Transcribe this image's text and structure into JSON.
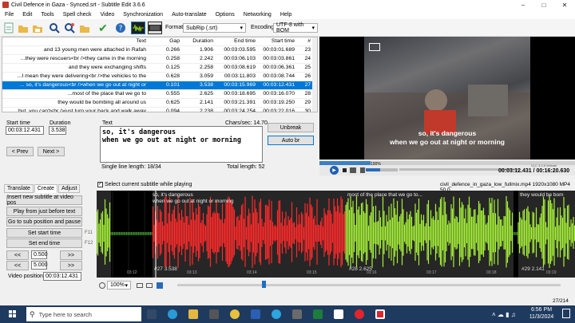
{
  "window": {
    "title": "Civil Defence in Gaza - Synced.srt - Subtitle Edit 3.6.6"
  },
  "menu": [
    "File",
    "Edit",
    "Tools",
    "Spell check",
    "Video",
    "Synchronization",
    "Auto-translate",
    "Options",
    "Networking",
    "Help"
  ],
  "toolbar": {
    "format_label": "Format",
    "format_value": "SubRip (.srt)",
    "encoding_label": "Encoding",
    "encoding_value": "UTF-8 with BOM",
    "icons": [
      "new-file-icon",
      "open-folder-icon",
      "save-icon",
      "save-as-icon",
      "find-icon",
      "replace-icon",
      "spell-check-icon",
      "help-icon",
      "waveform-toggle-icon",
      "video-toggle-icon"
    ]
  },
  "grid": {
    "headers": [
      "Text",
      "Gap",
      "Duration",
      "End time",
      "Start time",
      "#"
    ],
    "rows": [
      {
        "text": "and 13 young men were attached in Rafah",
        "gap": "0.266",
        "duration": "1.906",
        "end": "00:03:03.595",
        "start": "00:03:01.689",
        "num": "23"
      },
      {
        "text": "...they were rescuers<br />they came in the morning",
        "gap": "0.258",
        "duration": "2.242",
        "end": "00:03:06.103",
        "start": "00:03:03.861",
        "num": "24"
      },
      {
        "text": "and they were exchanging shifts",
        "gap": "0.125",
        "duration": "2.258",
        "end": "00:03:08.619",
        "start": "00:03:06.361",
        "num": "25"
      },
      {
        "text": "...I mean they were delivering<br />the vehicles to the",
        "gap": "0.628",
        "duration": "3.059",
        "end": "00:03:11.803",
        "start": "00:03:08.744",
        "num": "26"
      },
      {
        "text": "... so, it's dangerous<br />when we go out at night or",
        "gap": "0.101",
        "duration": "3.538",
        "end": "00:03:15.969",
        "start": "00:03:12.431",
        "num": "27",
        "selected": true
      },
      {
        "text": "...most of the place that we go to",
        "gap": "0.555",
        "duration": "2.625",
        "end": "00:03:18.695",
        "start": "00:03:16.070",
        "num": "28"
      },
      {
        "text": "they would be bombing all around us",
        "gap": "0.625",
        "duration": "2.141",
        "end": "00:03:21.391",
        "start": "00:03:19.250",
        "num": "29"
      },
      {
        "text": "but, you can't<br />just turn your back and walk away",
        "gap": "0.094",
        "duration": "2.238",
        "end": "00:03:24.254",
        "start": "00:03:22.016",
        "num": "30"
      }
    ]
  },
  "editor": {
    "start_time_label": "Start time",
    "start_time_value": "00:03:12.431",
    "duration_label": "Duration",
    "duration_value": "3.538",
    "prev_label": "< Prev",
    "next_label": "Next >",
    "text_label": "Text",
    "chars_sec": "Chars/sec: 14.70",
    "text_line1": "so, it's dangerous",
    "text_line2": "when we go out at night or morning",
    "single_line_length": "Single line length: 18/34",
    "total_length": "Total length: 52",
    "unbreak_label": "Unbreak",
    "autobr_label": "Auto br"
  },
  "video": {
    "subtitle_line1": "so, it's dangerous",
    "subtitle_line2": "when we go out at night or morning",
    "time_display": "00:03:12.431 / 00:16:20.630",
    "volume": "100%",
    "vlc_label": "VLC 3.0.8 Vetinari",
    "volume_fraction": 0.45,
    "progress_fraction": 0.2
  },
  "tabs": [
    "Translate",
    "Create",
    "Adjust"
  ],
  "active_tab": "Create",
  "create": {
    "insert_label": "Insert new subtitle at video pos",
    "play_label": "Play from just before text",
    "goto_label": "Go to sub position and pause",
    "set_start_label": "Set start time",
    "set_end_label": "Set end time",
    "f11": "F11",
    "f12": "F12",
    "step1_back": "<<",
    "step1_value": "0.500",
    "step1_fwd": ">>",
    "step2_back": "<<",
    "step2_value": "5.000",
    "step2_fwd": ">>",
    "video_position_label": "Video position:",
    "video_position_value": "00:03:12.431"
  },
  "waveform": {
    "select_current_label": "Select current subtitle while playing",
    "file_info": "civil_defence_in_gaza_low_fullmix.mp4 1920x1080 MP4 50.0",
    "seg1_text": "so, it's dangerous",
    "seg1_text2": "when we go out at night or morning",
    "seg1_info": "#27 3.538",
    "seg2_text": "most of the place that we go to...",
    "seg2_info": "#28 2.625",
    "seg3_text": "they would be bom",
    "seg3_info": "#29 2.141",
    "ticks": [
      "03:12",
      "03:13",
      "03:14",
      "03:15",
      "03:16",
      "03:17",
      "03:18",
      "03:19"
    ],
    "zoom": "100%",
    "colors": {
      "selected": "#ff2a2a",
      "other": "#a6f03a",
      "base": "#3a8a2a"
    }
  },
  "status": {
    "counter": "27/214"
  },
  "taskbar": {
    "search_placeholder": "Type here to search",
    "time": "6:56 PM",
    "date": "11/3/2024"
  }
}
